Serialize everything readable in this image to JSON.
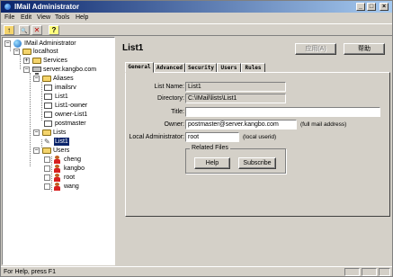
{
  "window": {
    "title": "IMail Administrator",
    "controls": {
      "minimize": "_",
      "maximize": "□",
      "close": "×"
    }
  },
  "menubar": [
    {
      "label": "File"
    },
    {
      "label": "Edit"
    },
    {
      "label": "View"
    },
    {
      "label": "Tools"
    },
    {
      "label": "Help"
    }
  ],
  "toolbar": {
    "up_icon": "↑",
    "find_icon": "🔍",
    "delete_icon": "✕",
    "help_icon": "?"
  },
  "tree": {
    "root": "IMail Administrator",
    "localhost": "localhost",
    "services": "Services",
    "server": "server.kangbo.com",
    "aliases": "Aliases",
    "alias_items": [
      "imailsrv",
      "List1",
      "List1-owner",
      "owner-List1",
      "postmaster"
    ],
    "lists": "Lists",
    "selected_list": "List1",
    "users": "Users",
    "user_items": [
      "cheng",
      "kangbo",
      "root",
      "wang"
    ]
  },
  "detail": {
    "title": "List1",
    "apply_button": "应用(A)",
    "help_button": "帮助",
    "tabs": [
      "General",
      "Advanced",
      "Security",
      "Users",
      "Rules"
    ],
    "fields": {
      "list_name_label": "List Name:",
      "list_name_value": "List1",
      "directory_label": "Directory:",
      "directory_value": "C:\\IMail\\lists\\List1",
      "title_label": "Title:",
      "title_value": "",
      "owner_label": "Owner:",
      "owner_value": "postmaster@server.kangbo.com",
      "owner_hint": "(full mail address)",
      "local_admin_label": "Local Administrator:",
      "local_admin_value": "root",
      "local_admin_hint": "(local userid)"
    },
    "related_files": {
      "label": "Related Files",
      "help_button": "Help",
      "subscribe_button": "Subscribe"
    }
  },
  "statusbar": {
    "text": "For Help, press F1"
  }
}
